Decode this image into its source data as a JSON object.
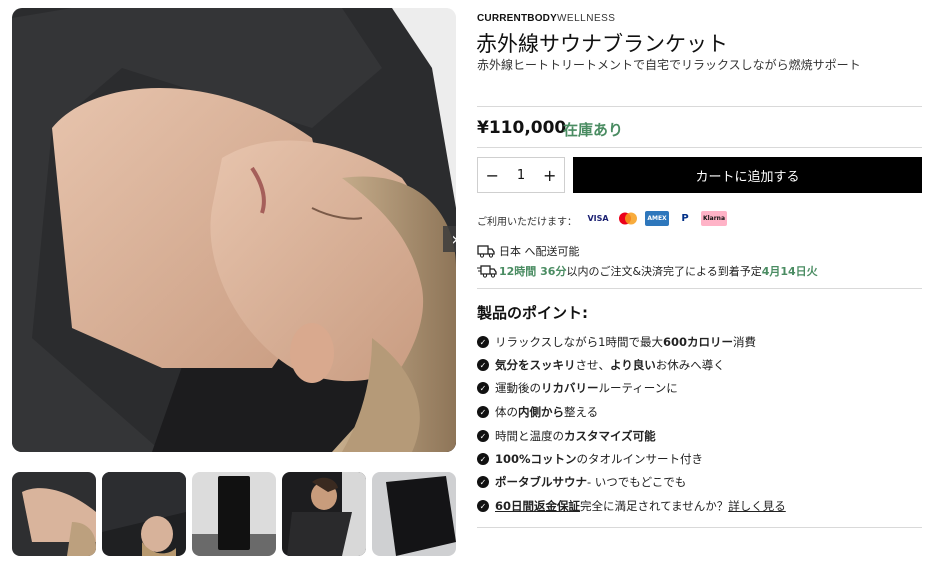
{
  "brand": {
    "bold": "CURRENTBODY",
    "light": "WELLNESS"
  },
  "product": {
    "title": "赤外線サウナブランケット",
    "subtitle": "赤外線ヒートトリートメントで自宅でリラックスしながら燃焼サポート",
    "price": "¥110,000",
    "stock": "在庫あり"
  },
  "cart": {
    "minus": "−",
    "quantity": "1",
    "plus": "+",
    "add_label": "カートに追加する"
  },
  "payment": {
    "label": "ご利用いただけます：",
    "methods": [
      {
        "name": "VISA",
        "icon": "visa-icon"
      },
      {
        "name": "Mastercard",
        "icon": "mastercard-icon"
      },
      {
        "name": "AMEX",
        "icon": "amex-icon"
      },
      {
        "name": "PayPal",
        "icon": "paypal-icon"
      },
      {
        "name": "Klarna",
        "icon": "klarna-icon"
      }
    ]
  },
  "shipping": {
    "line1": "日本 へ配送可能",
    "time": "12時間 36分",
    "line2_mid": " 以内のご注文&決済完了による到着予定 ",
    "date": "4月14日火"
  },
  "features": {
    "title": "製品のポイント:",
    "f1a": "リラックスしながら1時間で最大",
    "f1b": "600カロリー",
    "f1c": "消費",
    "f2a": "気分をスッキリ",
    "f2b": "させ、",
    "f2c": "より良い",
    "f2d": "お休みへ導く",
    "f3a": "運動後の",
    "f3b": "リカバリー",
    "f3c": "ルーティーンに",
    "f4a": "体の",
    "f4b": "内側から",
    "f4c": "整える",
    "f5a": "時間と温度の",
    "f5b": "カスタマイズ可能",
    "f6a": "100%コットン",
    "f6b": "のタオルインサート付き",
    "f7a": "ポータブルサウナ",
    "f7b": " - いつでもどこでも",
    "f8a": "60日間返金保証",
    "f8b": " 完全に満足されてませんか？ ",
    "f8c": "詳しく見る"
  },
  "gallery": {
    "next_icon": "chevron-right-icon",
    "thumb_count": 5
  },
  "colors": {
    "accent_green": "#4a8c62",
    "button_black": "#000000"
  }
}
